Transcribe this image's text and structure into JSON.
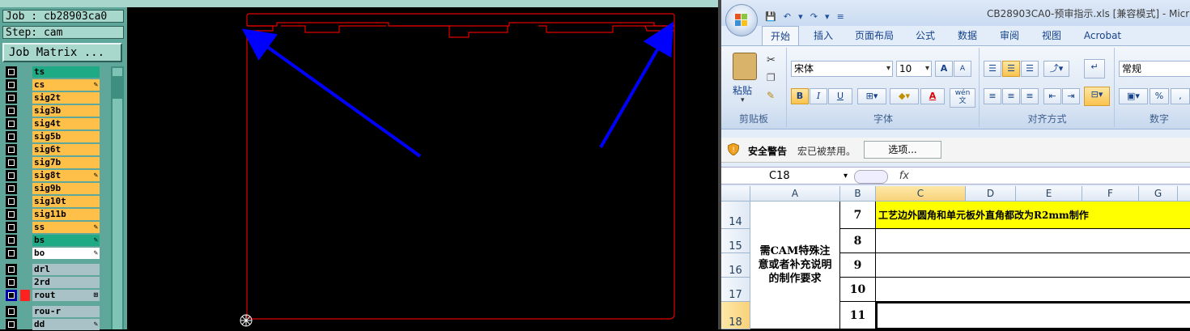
{
  "cam": {
    "job_label": "Job : cb28903ca0",
    "step_label": "Step: cam",
    "matrix_button": "Job Matrix ...",
    "layers": [
      {
        "name": "ts",
        "color": "#1faa86",
        "mark": "",
        "box": "#000"
      },
      {
        "name": "cs",
        "color": "#ffc04a",
        "mark": "✎",
        "box": "#000"
      },
      {
        "name": "sig2t",
        "color": "#ffc04a",
        "mark": "",
        "box": "#000"
      },
      {
        "name": "sig3b",
        "color": "#ffc04a",
        "mark": "",
        "box": "#000"
      },
      {
        "name": "sig4t",
        "color": "#ffc04a",
        "mark": "",
        "box": "#000"
      },
      {
        "name": "sig5b",
        "color": "#ffc04a",
        "mark": "",
        "box": "#000"
      },
      {
        "name": "sig6t",
        "color": "#ffc04a",
        "mark": "",
        "box": "#000"
      },
      {
        "name": "sig7b",
        "color": "#ffc04a",
        "mark": "",
        "box": "#000"
      },
      {
        "name": "sig8t",
        "color": "#ffc04a",
        "mark": "✎",
        "box": "#000"
      },
      {
        "name": "sig9b",
        "color": "#ffc04a",
        "mark": "",
        "box": "#000"
      },
      {
        "name": "sig10t",
        "color": "#ffc04a",
        "mark": "",
        "box": "#000"
      },
      {
        "name": "sig11b",
        "color": "#ffc04a",
        "mark": "",
        "box": "#000"
      },
      {
        "name": "ss",
        "color": "#ffc04a",
        "mark": "✎",
        "box": "#000"
      },
      {
        "name": "bs",
        "color": "#1faa86",
        "mark": "✎",
        "box": "#000"
      },
      {
        "name": "bo",
        "color": "#ffffff",
        "mark": "✎",
        "box": "#000"
      }
    ],
    "layers2": [
      {
        "name": "drl",
        "color": "#a9c2c8",
        "mark": "",
        "box": "#000"
      },
      {
        "name": "2rd",
        "color": "#a9c2c8",
        "mark": "",
        "box": "#000"
      },
      {
        "name": "rout",
        "color": "#a9c2c8",
        "mark": "⊞",
        "box": "#0000aa"
      }
    ],
    "layers3": [
      {
        "name": "rou-r",
        "color": "#a9c2c8",
        "mark": "",
        "box": "#000"
      },
      {
        "name": "dd",
        "color": "#a9c2c8",
        "mark": "✎",
        "box": "#000"
      }
    ]
  },
  "excel": {
    "title": "CB28903CA0-预审指示.xls  [兼容模式] - Micr",
    "qat": [
      "💾",
      "↶",
      "▾",
      "↷",
      "▾",
      "≡"
    ],
    "tabs": [
      "开始",
      "插入",
      "页面布局",
      "公式",
      "数据",
      "审阅",
      "视图",
      "Acrobat"
    ],
    "ribbon": {
      "paste_label": "粘贴",
      "clipboard_label": "剪贴板",
      "font_name": "宋体",
      "font_size": "10",
      "font_label": "字体",
      "align_label": "对齐方式",
      "number_format": "常规",
      "number_label": "数字",
      "bold": "B",
      "italic": "I",
      "underline": "U",
      "font_color_letter": "A",
      "grow_font": "A",
      "shrink_font": "A",
      "wen_label": "wén\n文",
      "percent": "%",
      "comma": ","
    },
    "security": {
      "title": "安全警告",
      "message": "宏已被禁用。",
      "options_button": "选项..."
    },
    "name_box": "C18",
    "fx_label": "fx",
    "columns": [
      "A",
      "B",
      "C",
      "D",
      "E",
      "F",
      "G"
    ],
    "rows": [
      "14",
      "15",
      "16",
      "17",
      "18"
    ],
    "merged_a_text": "需CAM特殊注意或者补充说明的制作要求",
    "b_values": [
      "7",
      "8",
      "9",
      "10",
      "11"
    ],
    "highlight_text": "工艺边外圆角和单元板外直角都改为R2mm制作",
    "highlight_color": "#ffff00"
  }
}
